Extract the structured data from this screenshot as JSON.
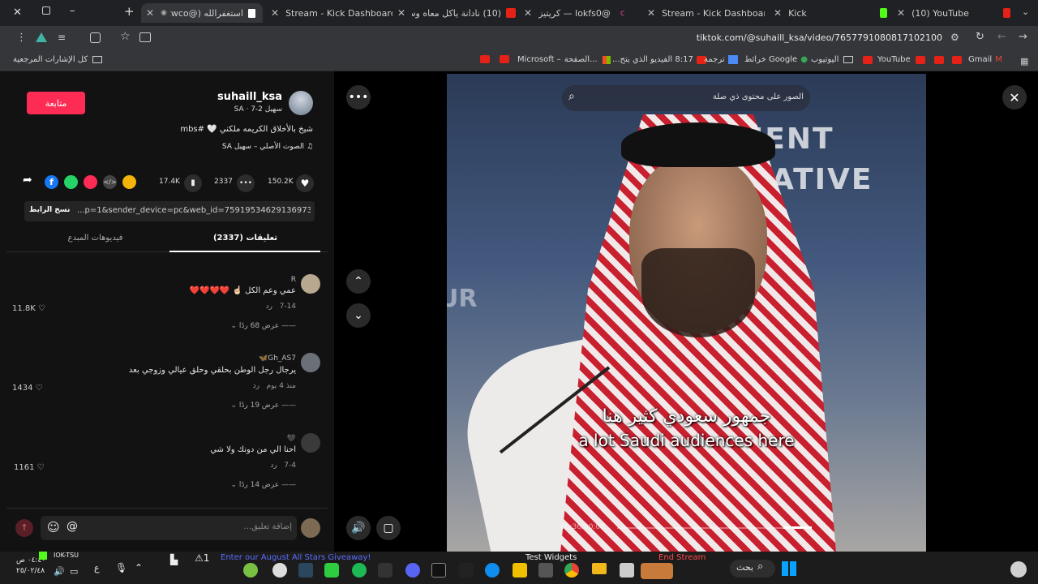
{
  "tabs": [
    {
      "title": "استغفرالله (@Szwco)",
      "color": "#ffffff",
      "active": true
    },
    {
      "title": "Stream - Kick Dashboard",
      "color": "#53fc18"
    },
    {
      "title": "(10) نادانة ياكل معاه وسوى",
      "color": "#e62117"
    },
    {
      "title": "كريتيز — lokfs0@",
      "color": "#e84393"
    },
    {
      "title": "Stream - Kick Dashboard",
      "color": "#53fc18"
    },
    {
      "title": "Kick",
      "color": "#53fc18"
    },
    {
      "title": "(10) YouTube",
      "color": "#e62117"
    }
  ],
  "address": {
    "url": "tiktok.com/@suhaill_ksa/video/7657791080817102100"
  },
  "bookmarks": {
    "all": "كل الإشارات المرجعية",
    "items": [
      "Gmail",
      "YouTube",
      "اليوتيوب",
      "خرائط Google",
      "ترجمة",
      "8:17 الفيديو الذي يتح...",
      "الصفحة...",
      "Microsoft –"
    ]
  },
  "profile": {
    "username": "suhaill_ksa",
    "meta": "سهيل SA · 7-2",
    "follow": "متابعة",
    "caption": "شيخ بالأخلاق الكريمه ملكني 🤍 #mbs",
    "sound": "الصوت الأصلي – سهيل SA",
    "likes": "150.2K",
    "comments": "2337",
    "saves": "17.4K",
    "link": "...p=1&sender_device=pc&web_id=7591953462913697336",
    "copy_link": "نسخ الرابط"
  },
  "tabs_panel": {
    "comments": "(2337) تعليقات",
    "creator": "فيديوهات المبدع"
  },
  "comments": [
    {
      "user": "R",
      "text": "عمي وعم الكل ☝🏻 ❤️❤️❤️❤️",
      "date": "7-14",
      "reply": "رد",
      "likes": "11.8K",
      "view": "عرض 68 ردًا"
    },
    {
      "user": "Gh_AS7🦋",
      "text": "يرجال رجل الوطن بحلقي وحلق عيالي وزوجي بعد",
      "date": "منذ 4 يوم",
      "reply": "رد",
      "likes": "1434",
      "view": "عرض 19 ردًا"
    },
    {
      "user": "🖤",
      "text": "احنا الي من دونك ولا شي",
      "date": "7-4",
      "reply": "رد",
      "likes": "1161",
      "view": "عرض 14 ردًا"
    }
  ],
  "compose": {
    "placeholder": "إضافة تعليق..."
  },
  "video": {
    "search_placeholder": "الصور على محتوى ذي صلة",
    "caption_ar": "جمهور سعودي كثير هنا",
    "caption_en": "a lot Saudi audiences here",
    "time": "00:36/00:05",
    "bg_text1": "UR",
    "bg_text2": "STMENT",
    "bg_text3": "ATIVE"
  },
  "taskbar": {
    "time": "٠٤:٤٠ ص",
    "date": "٢٥/٠٢/٤٨",
    "lang": "ع",
    "kick_label": "IOK-TSU",
    "kick_value": "1",
    "giveaway": "Enter our August All Stars Giveaway!",
    "widgets": "Test Widgets",
    "end_stream": "End Stream",
    "search": "بحث"
  }
}
